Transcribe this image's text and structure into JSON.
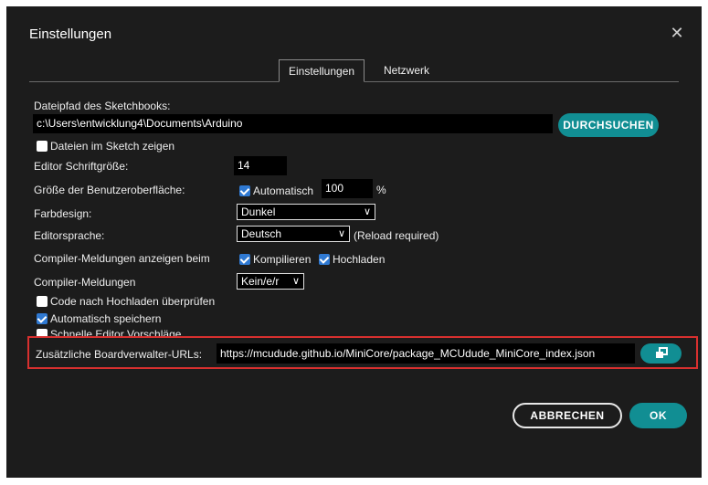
{
  "dialog": {
    "title": "Einstellungen",
    "close_icon": "close-icon"
  },
  "tabs": [
    {
      "label": "Einstellungen",
      "active": true
    },
    {
      "label": "Netzwerk",
      "active": false
    }
  ],
  "sketchbook": {
    "label": "Dateipfad des Sketchbooks:",
    "path": "c:\\Users\\entwicklung4\\Documents\\Arduino",
    "browse_button": "DURCHSUCHEN",
    "show_files_label": "Dateien im Sketch zeigen",
    "show_files_checked": false
  },
  "font_size": {
    "label": "Editor Schriftgröße:",
    "value": "14"
  },
  "ui_scale": {
    "label": "Größe der Benutzeroberfläche:",
    "auto_label": "Automatisch",
    "auto_checked": true,
    "value": "100",
    "unit": "%"
  },
  "theme": {
    "label": "Farbdesign:",
    "selected": "Dunkel"
  },
  "language": {
    "label": "Editorsprache:",
    "selected": "Deutsch",
    "note": "(Reload required)"
  },
  "compiler_output": {
    "label": "Compiler-Meldungen anzeigen beim",
    "compile_label": "Kompilieren",
    "compile_checked": true,
    "upload_label": "Hochladen",
    "upload_checked": true
  },
  "compiler_warnings": {
    "label": "Compiler-Meldungen",
    "selected": "Kein/e/r"
  },
  "options": [
    {
      "label": "Code nach Hochladen überprüfen",
      "checked": false
    },
    {
      "label": "Automatisch speichern",
      "checked": true
    },
    {
      "label": "Schnelle Editor Vorschläge",
      "checked": false
    }
  ],
  "board_urls": {
    "label": "Zusätzliche Boardverwalter-URLs:",
    "value": "https://mcudude.github.io/MiniCore/package_MCUdude_MiniCore_index.json",
    "button_icon": "open-window-icon"
  },
  "footer": {
    "cancel_label": "ABBRECHEN",
    "ok_label": "OK"
  },
  "colors": {
    "background": "#1c1c1c",
    "accent": "#118e93",
    "highlight": "#d8302f",
    "checkbox": "#2f79d2"
  }
}
